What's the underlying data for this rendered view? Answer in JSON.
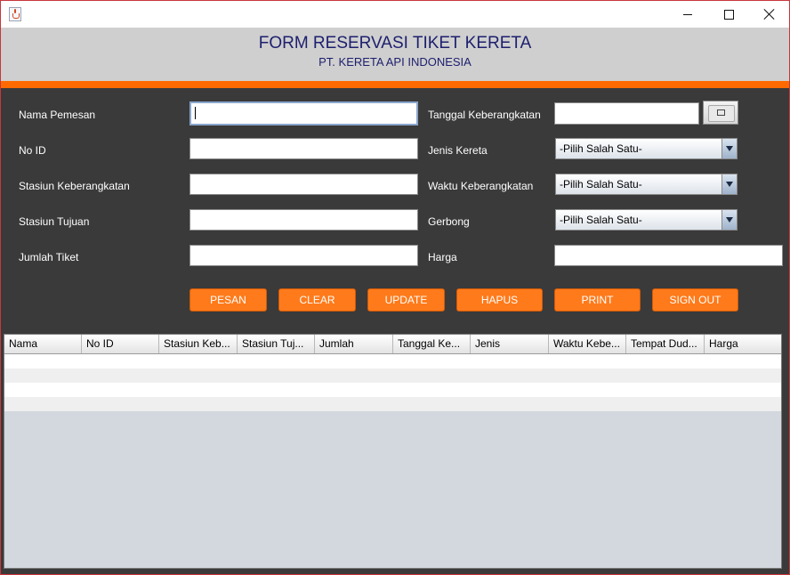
{
  "window": {
    "minimize_icon": "minimize-icon",
    "maximize_icon": "maximize-icon",
    "close_icon": "close-icon",
    "app_icon": "java-cup-icon"
  },
  "header": {
    "title": "FORM RESERVASI TIKET KERETA",
    "subtitle": "PT. KERETA API INDONESIA"
  },
  "form": {
    "nama_pemesan": {
      "label": "Nama Pemesan",
      "value": ""
    },
    "no_id": {
      "label": "No ID",
      "value": ""
    },
    "stasiun_keberangkatan": {
      "label": "Stasiun Keberangkatan",
      "value": ""
    },
    "stasiun_tujuan": {
      "label": "Stasiun Tujuan",
      "value": ""
    },
    "jumlah_tiket": {
      "label": "Jumlah Tiket",
      "value": ""
    },
    "tanggal_keberangkatan": {
      "label": "Tanggal Keberangkatan",
      "value": ""
    },
    "jenis_kereta": {
      "label": "Jenis Kereta",
      "selected": "-Pilih Salah Satu-"
    },
    "waktu_keberangkatan": {
      "label": "Waktu Keberangkatan",
      "selected": "-Pilih Salah Satu-"
    },
    "gerbong": {
      "label": "Gerbong",
      "selected": "-Pilih Salah Satu-"
    },
    "harga": {
      "label": "Harga",
      "value": ""
    }
  },
  "buttons": {
    "pesan": "PESAN",
    "clear": "CLEAR",
    "update": "UPDATE",
    "hapus": "HAPUS",
    "print": "PRINT",
    "sign_out": "SIGN OUT"
  },
  "table": {
    "columns": [
      "Nama",
      "No ID",
      "Stasiun Keb...",
      "Stasiun Tuj...",
      "Jumlah",
      "Tanggal Ke...",
      "Jenis",
      "Waktu Kebe...",
      "Tempat Dud...",
      "Harga"
    ],
    "rows": []
  },
  "colors": {
    "accent": "#ff6a00",
    "button": "#ff7a1a",
    "header_bg": "#cfcfcf",
    "form_bg": "#3a3a3a",
    "title_text": "#1d1f6e"
  }
}
